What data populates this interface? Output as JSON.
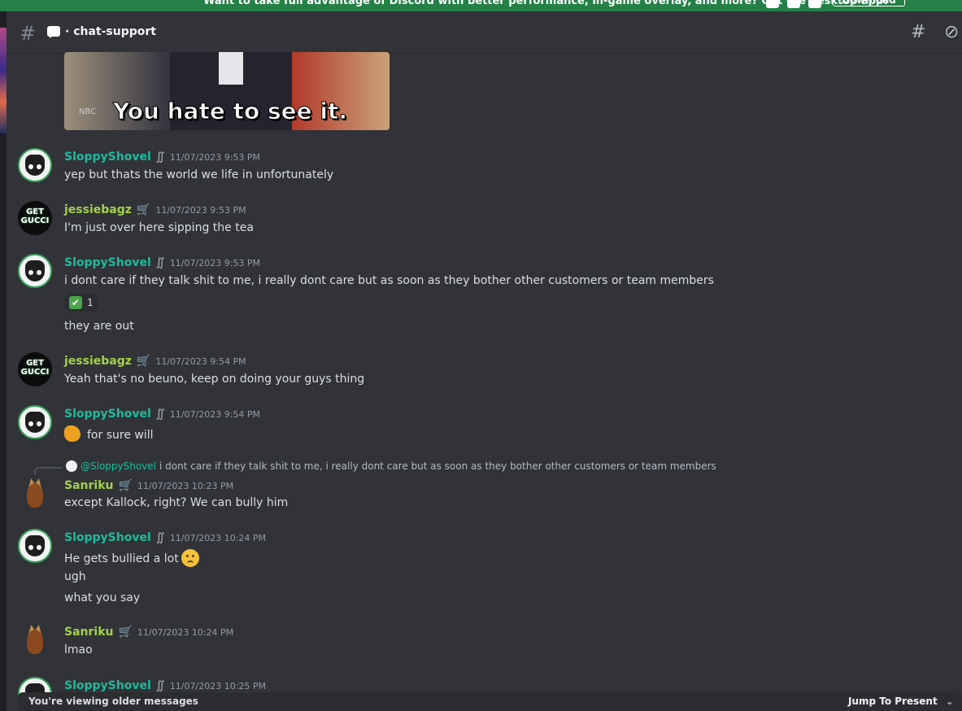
{
  "banner": {
    "text": "Want to take full advantage of Discord with better performance, in-game overlay, and more? Get the desktop app!",
    "button": "Download",
    "icons": [
      "apple-icon",
      "android-icon",
      "windows-icon"
    ]
  },
  "header": {
    "channel_name": "· chat-support",
    "icons": [
      "hash-icon",
      "chat-bubble-icon",
      "threads-icon",
      "mute-icon"
    ]
  },
  "gif": {
    "caption": "You hate to see it.",
    "logo": "NBC"
  },
  "messages": [
    {
      "user": "SloppyShovel",
      "role_icon": "∬",
      "time": "11/07/2023 9:53 PM",
      "lines": [
        "yep but thats the world we life in unfortunately"
      ]
    },
    {
      "user": "jessiebagz",
      "role_icon": "🛒",
      "time": "11/07/2023 9:53 PM",
      "avatar_text": "GET GUCCI",
      "lines": [
        "I'm just over here sipping the tea"
      ]
    },
    {
      "user": "SloppyShovel",
      "role_icon": "∬",
      "time": "11/07/2023 9:53 PM",
      "lines": [
        "i dont care if they talk shit to me, i really dont care but as soon as they bother other customers or team members",
        "they are out"
      ],
      "reaction": {
        "emoji": "✔",
        "count": "1"
      }
    },
    {
      "user": "jessiebagz",
      "role_icon": "🛒",
      "time": "11/07/2023 9:54 PM",
      "avatar_text": "GET GUCCI",
      "lines": [
        "Yeah that's no beuno, keep on doing your guys thing"
      ]
    },
    {
      "user": "SloppyShovel",
      "role_icon": "∬",
      "time": "11/07/2023 9:54 PM",
      "lines": [
        "for sure will"
      ]
    },
    {
      "user": "Sanriku",
      "role_icon": "🛒",
      "time": "11/07/2023 10:23 PM",
      "reply_user": "@SloppyShovel",
      "reply_text": "i dont care if they talk shit to me, i really dont care but as soon as they bother other customers or team members",
      "lines": [
        "except Kallock, right? We can bully him"
      ]
    },
    {
      "user": "SloppyShovel",
      "role_icon": "∬",
      "time": "11/07/2023 10:24 PM",
      "lines": [
        "He gets bullied a lot",
        "ugh",
        "what you say"
      ]
    },
    {
      "user": "Sanriku",
      "role_icon": "🛒",
      "time": "11/07/2023 10:24 PM",
      "lines": [
        "lmao"
      ]
    },
    {
      "user": "SloppyShovel",
      "role_icon": "∬",
      "time": "11/07/2023 10:25 PM",
      "lines": []
    }
  ],
  "older_bar": {
    "text": "You're viewing older messages",
    "jump": "Jump To Present"
  }
}
